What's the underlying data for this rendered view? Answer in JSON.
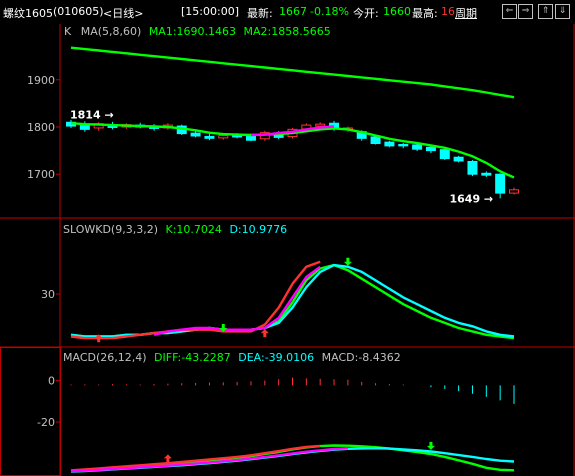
{
  "header": {
    "symbol": "螺纹1605",
    "code": "(010605)",
    "period": "<日线>",
    "time": "[15:00:00]",
    "latest_label": "最新:",
    "latest_value": "1667",
    "change_pct": "-0.18%",
    "open_label": "今开:",
    "open_value": "1660",
    "high_label": "最高:",
    "high_value": "16",
    "cycle_button": "周期",
    "nav_icons": [
      "arrow-left-icon",
      "arrow-right-icon",
      "zoom-in-icon",
      "zoom-out-icon"
    ]
  },
  "colors": {
    "background": "#000000",
    "border": "#c00000",
    "up": "#ff3232",
    "down": "#00ffff",
    "green": "#00ff00",
    "magenta": "#ff00ff",
    "white": "#ffffff",
    "yellow": "#ffff00"
  },
  "chart_data": [
    {
      "type": "line",
      "name": "price",
      "legend": {
        "k_label": "K",
        "ma_label": "MA(5,8,60)",
        "ma1": "MA1:1690.1463",
        "ma2": "MA2:1858.5665"
      },
      "yticks": [
        1900,
        1800,
        1700
      ],
      "ylim": [
        1620,
        1980
      ],
      "annotations": [
        {
          "text": "1814",
          "value": 1814
        },
        {
          "text": "1649",
          "value": 1649
        }
      ],
      "candles": [
        {
          "o": 1810,
          "c": 1802,
          "h": 1815,
          "l": 1798
        },
        {
          "o": 1803,
          "c": 1795,
          "h": 1812,
          "l": 1790
        },
        {
          "o": 1798,
          "c": 1807,
          "h": 1810,
          "l": 1792
        },
        {
          "o": 1805,
          "c": 1799,
          "h": 1811,
          "l": 1795
        },
        {
          "o": 1800,
          "c": 1805,
          "h": 1808,
          "l": 1796
        },
        {
          "o": 1804,
          "c": 1800,
          "h": 1809,
          "l": 1797
        },
        {
          "o": 1801,
          "c": 1797,
          "h": 1806,
          "l": 1792
        },
        {
          "o": 1798,
          "c": 1804,
          "h": 1808,
          "l": 1794
        },
        {
          "o": 1802,
          "c": 1786,
          "h": 1805,
          "l": 1783
        },
        {
          "o": 1787,
          "c": 1781,
          "h": 1793,
          "l": 1778
        },
        {
          "o": 1780,
          "c": 1776,
          "h": 1786,
          "l": 1772
        },
        {
          "o": 1777,
          "c": 1782,
          "h": 1785,
          "l": 1773
        },
        {
          "o": 1781,
          "c": 1779,
          "h": 1787,
          "l": 1776
        },
        {
          "o": 1782,
          "c": 1772,
          "h": 1786,
          "l": 1770
        },
        {
          "o": 1775,
          "c": 1788,
          "h": 1792,
          "l": 1771
        },
        {
          "o": 1786,
          "c": 1778,
          "h": 1791,
          "l": 1774
        },
        {
          "o": 1780,
          "c": 1795,
          "h": 1798,
          "l": 1776
        },
        {
          "o": 1796,
          "c": 1804,
          "h": 1808,
          "l": 1792
        },
        {
          "o": 1802,
          "c": 1806,
          "h": 1810,
          "l": 1797
        },
        {
          "o": 1808,
          "c": 1796,
          "h": 1813,
          "l": 1792
        },
        {
          "o": 1795,
          "c": 1798,
          "h": 1801,
          "l": 1790
        },
        {
          "o": 1790,
          "c": 1776,
          "h": 1793,
          "l": 1771
        },
        {
          "o": 1779,
          "c": 1765,
          "h": 1782,
          "l": 1763
        },
        {
          "o": 1768,
          "c": 1760,
          "h": 1771,
          "l": 1757
        },
        {
          "o": 1763,
          "c": 1760,
          "h": 1766,
          "l": 1755
        },
        {
          "o": 1762,
          "c": 1753,
          "h": 1764,
          "l": 1749
        },
        {
          "o": 1757,
          "c": 1750,
          "h": 1760,
          "l": 1745
        },
        {
          "o": 1752,
          "c": 1733,
          "h": 1755,
          "l": 1730
        },
        {
          "o": 1736,
          "c": 1728,
          "h": 1739,
          "l": 1725
        },
        {
          "o": 1727,
          "c": 1700,
          "h": 1730,
          "l": 1696
        },
        {
          "o": 1702,
          "c": 1698,
          "h": 1706,
          "l": 1694
        },
        {
          "o": 1700,
          "c": 1660,
          "h": 1702,
          "l": 1649
        },
        {
          "o": 1660,
          "c": 1667,
          "h": 1672,
          "l": 1657
        }
      ],
      "series": [
        {
          "id": "ma-long",
          "color": "#00ff00",
          "values": [
            1968,
            1965,
            1962,
            1959,
            1956,
            1953,
            1950,
            1947,
            1944,
            1941,
            1938,
            1935,
            1932,
            1929,
            1926,
            1923,
            1920,
            1917,
            1914,
            1911,
            1908,
            1905,
            1902,
            1899,
            1896,
            1893,
            1890,
            1886,
            1882,
            1878,
            1873,
            1868,
            1863
          ]
        },
        {
          "id": "ma-short",
          "color": "#00ff00",
          "values": [
            1808,
            1806,
            1805,
            1804,
            1803,
            1802,
            1801,
            1800,
            1797,
            1793,
            1788,
            1785,
            1784,
            1783,
            1784,
            1785,
            1787,
            1791,
            1795,
            1797,
            1795,
            1789,
            1782,
            1775,
            1770,
            1766,
            1761,
            1756,
            1748,
            1738,
            1724,
            1706,
            1693
          ]
        },
        {
          "id": "ma-mid",
          "color": "#ff00ff",
          "values": [
            null,
            null,
            null,
            null,
            null,
            null,
            null,
            null,
            null,
            null,
            null,
            null,
            null,
            1783,
            1784,
            1787,
            1790,
            1795,
            1799,
            1801,
            null,
            null,
            null,
            null,
            null,
            null,
            null,
            null,
            null,
            null,
            null,
            null,
            null
          ]
        }
      ]
    },
    {
      "type": "line",
      "name": "slowkd",
      "legend": {
        "label": "SLOWKD(9,3,3,2)",
        "k": "K:10.7024",
        "d": "D:10.9776"
      },
      "yticks": [
        30
      ],
      "ylim": [
        0,
        60
      ],
      "series": [
        {
          "id": "k-green",
          "color": "#00ff00",
          "values": [
            6,
            5,
            5,
            5,
            6,
            6,
            7,
            7,
            8,
            9,
            10,
            9,
            9,
            9,
            10,
            14,
            25,
            38,
            45,
            47,
            44,
            39,
            34,
            29,
            24,
            20,
            16,
            13,
            10,
            8,
            6,
            5,
            4
          ]
        },
        {
          "id": "d-cyan",
          "color": "#00ffff",
          "values": [
            6,
            5,
            5,
            5,
            6,
            6,
            7,
            7,
            8,
            9,
            10,
            9,
            9,
            9,
            10,
            13,
            22,
            34,
            43,
            47,
            46,
            43,
            38,
            33,
            28,
            24,
            20,
            16,
            13,
            11,
            8,
            6,
            5
          ]
        },
        {
          "id": "k-red",
          "color": "#ff3232",
          "values": [
            5,
            4,
            4,
            4,
            5,
            6,
            7,
            8,
            9,
            9,
            9,
            8,
            8,
            8,
            12,
            22,
            36,
            46,
            49,
            null,
            null,
            null,
            null,
            null,
            null,
            null,
            null,
            null,
            null,
            null,
            null,
            null,
            null
          ]
        },
        {
          "id": "d-magenta",
          "color": "#ff00ff",
          "values": [
            null,
            null,
            null,
            null,
            null,
            null,
            6,
            8,
            9,
            10,
            10,
            9,
            9,
            9,
            10,
            16,
            28,
            40,
            46,
            null,
            null,
            null,
            null,
            null,
            null,
            null,
            null,
            null,
            null,
            null,
            null,
            null,
            null
          ]
        }
      ],
      "markers": [
        {
          "i": 2,
          "dir": "up",
          "color": "#ff3232",
          "value": 4
        },
        {
          "i": 11,
          "dir": "down",
          "color": "#00ff00",
          "value": 10
        },
        {
          "i": 14,
          "dir": "up",
          "color": "#ff3232",
          "value": 7
        },
        {
          "i": 20,
          "dir": "down",
          "color": "#00ff00",
          "value": 49
        }
      ]
    },
    {
      "type": "bar",
      "name": "macd",
      "legend": {
        "label": "MACD(26,12,4)",
        "diff": "DIFF:-43.2287",
        "dea": "DEA:-39.0106",
        "macd": "MACD:-8.4362"
      },
      "yticks": [
        0,
        -20
      ],
      "ylim": [
        -45,
        5
      ],
      "bars": [
        0.4,
        0.5,
        0.4,
        0.6,
        0.5,
        0.4,
        0.6,
        0.8,
        1.0,
        1.1,
        1.3,
        1.4,
        1.6,
        1.8,
        2.2,
        2.8,
        3.6,
        3.2,
        3.0,
        2.8,
        2.6,
        1.6,
        1.0,
        0.6,
        0.4,
        0,
        -0.8,
        -1.6,
        -2.6,
        -3.8,
        -5.2,
        -6.8,
        -8.4
      ],
      "series": [
        {
          "id": "diff-green",
          "color": "#00ff00",
          "values": [
            -43.5,
            -43.3,
            -42.8,
            -42.2,
            -41.7,
            -41.2,
            -40.7,
            -40.2,
            -39.6,
            -39.0,
            -38.4,
            -37.8,
            -37.2,
            -36.4,
            -35.4,
            -34.4,
            -33.2,
            -32.2,
            -31.6,
            -31.3,
            -31.4,
            -31.7,
            -32.1,
            -32.8,
            -33.6,
            -34.4,
            -35.4,
            -36.8,
            -38.4,
            -40.1,
            -42.0,
            -43.0,
            -43.2
          ]
        },
        {
          "id": "dea-cyan",
          "color": "#00ffff",
          "values": [
            -43.8,
            -43.6,
            -43.2,
            -42.8,
            -42.4,
            -42.0,
            -41.6,
            -41.2,
            -40.8,
            -40.3,
            -39.8,
            -39.2,
            -38.6,
            -37.9,
            -37.1,
            -36.3,
            -35.4,
            -34.6,
            -33.9,
            -33.3,
            -32.9,
            -32.7,
            -32.6,
            -32.8,
            -33.2,
            -33.6,
            -34.2,
            -35.0,
            -35.9,
            -36.8,
            -37.8,
            -38.6,
            -39.0
          ]
        },
        {
          "id": "diff-red",
          "color": "#ff3232",
          "values": [
            -43.2,
            -42.8,
            -42.3,
            -41.8,
            -41.3,
            -40.8,
            -40.3,
            -39.8,
            -39.2,
            -38.6,
            -38.0,
            -37.4,
            -36.8,
            -36.0,
            -35.0,
            -34.0,
            -32.9,
            -32.0,
            -31.5,
            null,
            null,
            null,
            null,
            null,
            null,
            null,
            null,
            null,
            null,
            null,
            null,
            null,
            null
          ]
        },
        {
          "id": "dea-magenta",
          "color": "#ff00ff",
          "values": [
            -43.6,
            -43.4,
            -43.0,
            -42.6,
            -42.2,
            -41.8,
            -41.4,
            -41.0,
            -40.5,
            -40.0,
            -39.5,
            -38.9,
            -38.3,
            -37.6,
            -36.8,
            -36.0,
            -35.1,
            -34.3,
            -33.6,
            -33.0,
            -32.6,
            null,
            null,
            null,
            null,
            null,
            null,
            null,
            null,
            null,
            null,
            null,
            null
          ]
        }
      ],
      "markers": [
        {
          "i": 7,
          "dir": "up",
          "color": "#ff3232",
          "value": -37.5
        },
        {
          "i": 26,
          "dir": "down",
          "color": "#00ff00",
          "value": -31.5
        }
      ]
    }
  ]
}
